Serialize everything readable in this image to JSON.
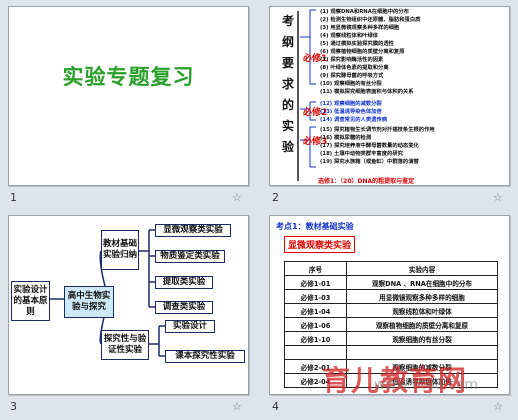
{
  "slides": [
    {
      "number": "1",
      "title": "实验专题复习"
    },
    {
      "number": "2",
      "vertical_title": "考纲要求的实验",
      "groups": [
        "必修1",
        "必修2",
        "必修3"
      ],
      "items": [
        "(1) 观察DNA和RNA在细胞中的分布",
        "(2) 检测生物组织中还原糖、脂肪和蛋白质",
        "(3) 用显微镜观察多种多样的细胞",
        "(4) 观察线粒体和叶绿体",
        "(5) 通过模拟实验探究膜的透性",
        "(6) 观察植物细胞的质壁分离和复原",
        "(7) 探究影响酶活性的因素",
        "(8) 叶绿体色素的提取和分离",
        "(9) 探究酵母菌的呼吸方式",
        "(10) 观察细胞的有丝分裂",
        "(11) 模拟探究细胞表面积与体积的关系",
        "(12) 观察细胞的减数分裂",
        "(13) 低温诱导染色体加倍",
        "(14) 调查常见的人类遗传病",
        "(15) 探究植物生长调节剂对扦插枝条生根的作用",
        "(16) 模拟尿糖的检测",
        "(17) 探究培养液中酵母菌数量的动态变化",
        "(18) 土壤中动物类群丰富度的研究",
        "(19) 探究水族箱（或鱼缸）中群落的演替"
      ],
      "footer": "选修1：（20）DNA的粗提取与鉴定"
    },
    {
      "number": "3",
      "left_box": "实验设计的基本原则",
      "center_box": "高中生物实验与探究",
      "branch_top": "教材基础实验归纳",
      "branch_bottom": "探究性与验证性实验",
      "leaves_top": [
        "显微观察类实验",
        "物质鉴定类实验",
        "提取类实验",
        "调查类实验"
      ],
      "leaves_bottom": [
        "实验设计",
        "课本探究性实验"
      ]
    },
    {
      "number": "4",
      "heading": "考点1：教材基础实验",
      "tag": "显微观察类实验",
      "columns": [
        "序号",
        "实验内容"
      ],
      "rows": [
        [
          "必修1-01",
          "观察DNA 、RNA在细胞中的分布"
        ],
        [
          "必修1-03",
          "用显微镜观察多种多样的细胞"
        ],
        [
          "必修1-04",
          "观察线粒体和叶绿体"
        ],
        [
          "必修1-06",
          "观察植物细胞的质壁分离和复原"
        ],
        [
          "必修1-10",
          "观察细胞的有丝分裂"
        ],
        [
          "",
          ""
        ],
        [
          "必修2-01",
          "观察细胞的减数分裂"
        ],
        [
          "必修2-04",
          "低温诱导染色体加倍"
        ]
      ],
      "watermark": "育儿教育网",
      "watermark_url": "www.ht88.com"
    }
  ],
  "star_glyph": "☆"
}
